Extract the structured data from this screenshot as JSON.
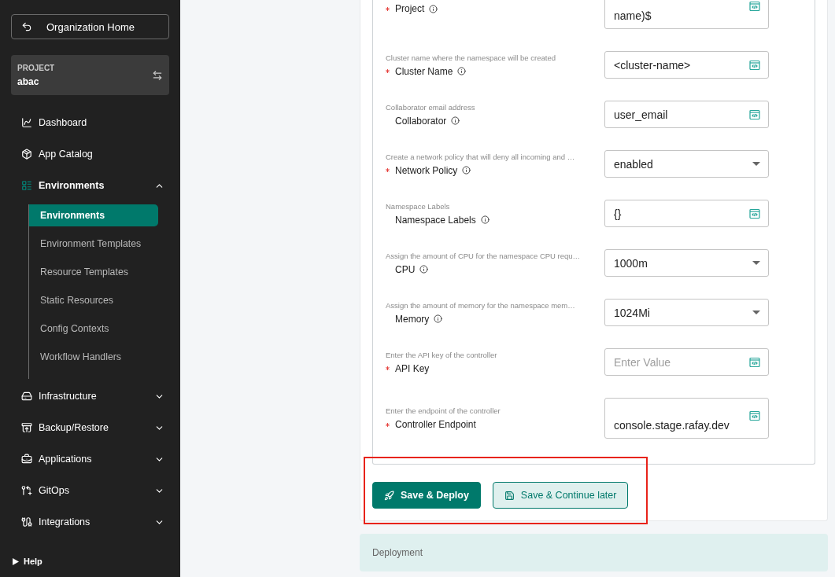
{
  "sidebar": {
    "org_home": "Organization Home",
    "project": {
      "label": "PROJECT",
      "name": "abac"
    },
    "nav": [
      {
        "label": "Dashboard",
        "kind": "link"
      },
      {
        "label": "App Catalog",
        "kind": "link"
      },
      {
        "label": "Environments",
        "kind": "group",
        "expanded": true,
        "children": [
          {
            "label": "Environments",
            "selected": true
          },
          {
            "label": "Environment Templates",
            "selected": false
          },
          {
            "label": "Resource Templates",
            "selected": false
          },
          {
            "label": "Static Resources",
            "selected": false
          },
          {
            "label": "Config Contexts",
            "selected": false
          },
          {
            "label": "Workflow Handlers",
            "selected": false
          }
        ]
      },
      {
        "label": "Infrastructure",
        "kind": "group",
        "expanded": false
      },
      {
        "label": "Backup/Restore",
        "kind": "group",
        "expanded": false
      },
      {
        "label": "Applications",
        "kind": "group",
        "expanded": false
      },
      {
        "label": "GitOps",
        "kind": "group",
        "expanded": false
      },
      {
        "label": "Integrations",
        "kind": "group",
        "expanded": false
      }
    ],
    "help": "Help"
  },
  "form": {
    "fields": [
      {
        "label": "Project",
        "required": true,
        "info": true,
        "kind": "text",
        "value": "name)$"
      },
      {
        "description": "Cluster name where the namespace will be created",
        "label": "Cluster Name",
        "required": true,
        "info": true,
        "kind": "text",
        "value": "<cluster-name>"
      },
      {
        "description": "Collaborator email address",
        "label": "Collaborator",
        "required": false,
        "info": true,
        "kind": "text",
        "value": "user_email"
      },
      {
        "description": "Create a network policy that will deny all incoming and …",
        "label": "Network Policy",
        "required": true,
        "info": true,
        "kind": "select",
        "value": "enabled"
      },
      {
        "description": "Namespace Labels",
        "label": "Namespace Labels",
        "required": false,
        "info": true,
        "kind": "text",
        "value": "{}"
      },
      {
        "description": "Assign the amount of CPU for the namespace CPU requ…",
        "label": "CPU",
        "required": false,
        "info": true,
        "kind": "select",
        "value": "1000m"
      },
      {
        "description": "Assign the amount of memory for the namespace mem…",
        "label": "Memory",
        "required": false,
        "info": true,
        "kind": "select",
        "value": "1024Mi"
      },
      {
        "description": "Enter the API key of the controller",
        "label": "API Key",
        "required": true,
        "info": false,
        "kind": "text",
        "placeholder": "Enter Value"
      },
      {
        "description": "Enter the endpoint of the controller",
        "label": "Controller Endpoint",
        "required": true,
        "info": false,
        "kind": "text",
        "value": "console.stage.rafay.dev"
      }
    ],
    "buttons": [
      {
        "label": "Save & Deploy",
        "kind": "primary"
      },
      {
        "label": "Save & Continue later",
        "kind": "secondary"
      }
    ]
  },
  "sections": [
    {
      "title": "Deployment"
    }
  ]
}
